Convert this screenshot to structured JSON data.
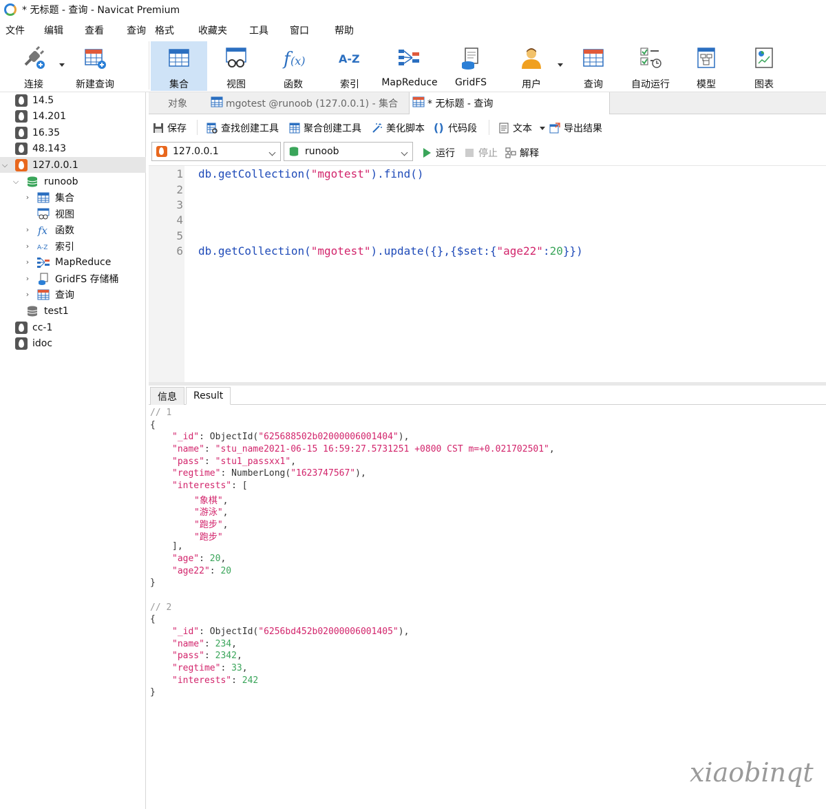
{
  "window": {
    "title": "* 无标题 - 查询 - Navicat Premium"
  },
  "menu": [
    "文件",
    "编辑",
    "查看",
    "查询",
    "格式",
    "收藏夹",
    "工具",
    "窗口",
    "帮助"
  ],
  "toolbar": {
    "connect": "连接",
    "new_query": "新建查询",
    "collection": "集合",
    "view": "视图",
    "function": "函数",
    "index": "索引",
    "mapreduce": "MapReduce",
    "gridfs": "GridFS",
    "user": "用户",
    "query": "查询",
    "auto_run": "自动运行",
    "model": "模型",
    "chart": "图表"
  },
  "sidebar": {
    "connections": [
      "14.5",
      "14.201",
      "16.35",
      "48.143",
      "127.0.0.1"
    ],
    "database": "runoob",
    "db_children": [
      "集合",
      "视图",
      "函数",
      "索引",
      "MapReduce",
      "GridFS 存储桶",
      "查询"
    ],
    "other_db": "test1",
    "more_connections": [
      "cc-1",
      "idoc"
    ]
  },
  "tabs": {
    "objects": "对象",
    "collection_tab": "mgotest @runoob (127.0.0.1) - 集合",
    "query_tab": "* 无标题 - 查询"
  },
  "query_toolbar": {
    "save": "保存",
    "find_builder": "查找创建工具",
    "aggregate_builder": "聚合创建工具",
    "beautify": "美化脚本",
    "snippet": "代码段",
    "text": "文本",
    "export": "导出结果"
  },
  "selects": {
    "connection": "127.0.0.1",
    "database": "runoob",
    "run": "运行",
    "stop": "停止",
    "explain": "解释"
  },
  "editor": {
    "line_numbers": [
      "1",
      "2",
      "3",
      "4",
      "5",
      "6"
    ],
    "line1": {
      "a": "db.getCollection(",
      "b": "\"mgotest\"",
      "c": ").find()"
    },
    "line6": {
      "a": "db.getCollection(",
      "b": "\"mgotest\"",
      "c": ").update({},{$set:{",
      "d": "\"age22\"",
      "e": ":",
      "f": "20",
      "g": "}})"
    }
  },
  "result_tabs": {
    "info": "信息",
    "result": "Result"
  },
  "results": {
    "doc1": {
      "comment": "// 1",
      "id_key": "\"_id\"",
      "id_fn": "ObjectId(",
      "id_val": "\"625688502b02000006001404\"",
      "name_key": "\"name\"",
      "name_val": "\"stu_name2021-06-15 16:59:27.5731251 +0800 CST m=+0.021702501\"",
      "pass_key": "\"pass\"",
      "pass_val": "\"stu1_passxx1\"",
      "regtime_key": "\"regtime\"",
      "regtime_fn": "NumberLong(",
      "regtime_val": "\"1623747567\"",
      "interests_key": "\"interests\"",
      "interests": [
        "\"象棋\"",
        "\"游泳\"",
        "\"跑步\"",
        "\"跑步\""
      ],
      "age_key": "\"age\"",
      "age_val": "20",
      "age22_key": "\"age22\"",
      "age22_val": "20"
    },
    "doc2": {
      "comment": "// 2",
      "id_key": "\"_id\"",
      "id_fn": "ObjectId(",
      "id_val": "\"6256bd452b02000006001405\"",
      "name_key": "\"name\"",
      "name_val": "234",
      "pass_key": "\"pass\"",
      "pass_val": "2342",
      "regtime_key": "\"regtime\"",
      "regtime_val": "33",
      "interests_key": "\"interests\"",
      "interests_val": "242"
    }
  },
  "watermark": "xiaobinqt",
  "colors": {
    "accent": "#cfe3f7",
    "string": "#d2246b",
    "number": "#3aa55a",
    "keyword": "#1e4ab8"
  }
}
